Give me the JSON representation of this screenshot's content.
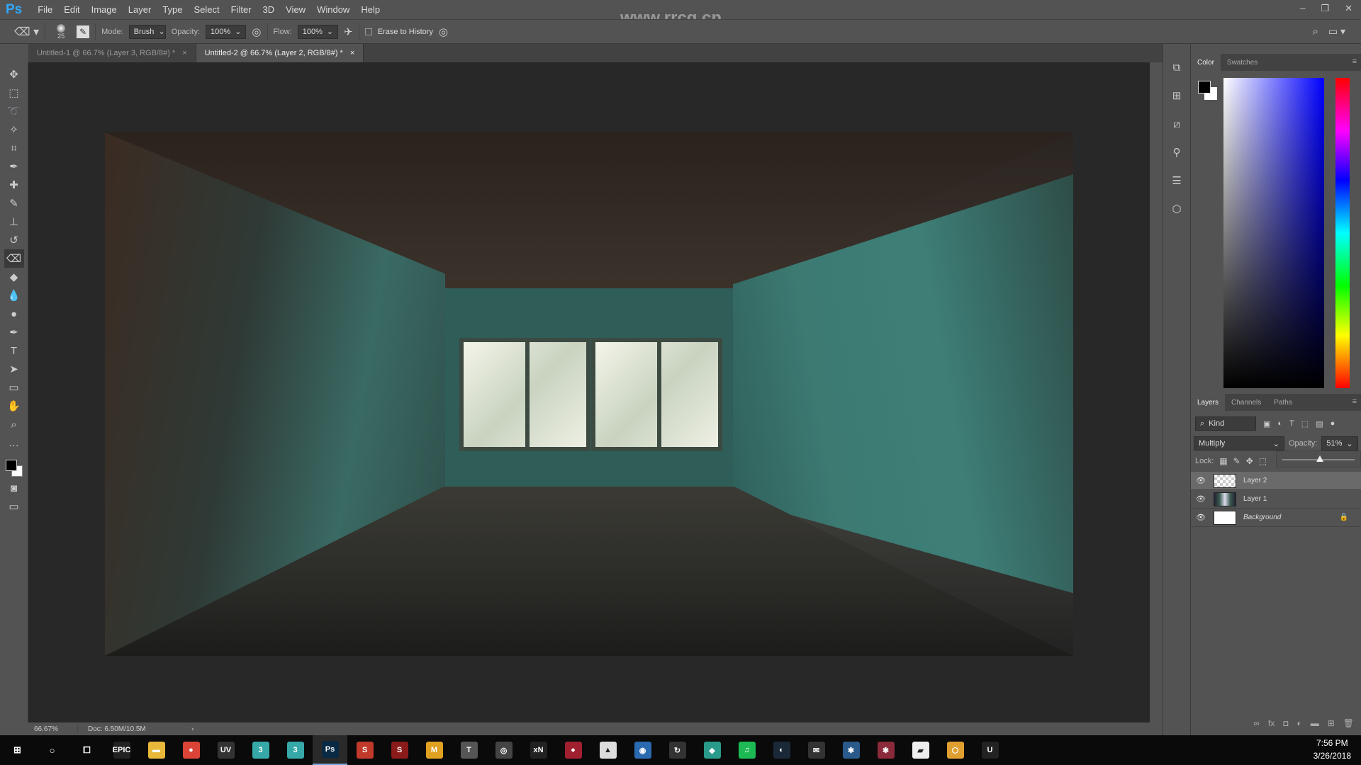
{
  "app": {
    "logo": "Ps",
    "watermark": "www.rrcg.cn"
  },
  "menu": [
    "File",
    "Edit",
    "Image",
    "Layer",
    "Type",
    "Select",
    "Filter",
    "3D",
    "View",
    "Window",
    "Help"
  ],
  "window_controls": [
    "–",
    "❐",
    "✕"
  ],
  "options": {
    "brush_size": "25",
    "mode_label": "Mode:",
    "mode_value": "Brush",
    "opacity_label": "Opacity:",
    "opacity_value": "100%",
    "flow_label": "Flow:",
    "flow_value": "100%",
    "erase_to_history": "Erase to History",
    "erase_to_history_checked": false
  },
  "tabs": [
    {
      "label": "Untitled-1 @ 66.7% (Layer 3, RGB/8#) *",
      "active": false
    },
    {
      "label": "Untitled-2 @ 66.7% (Layer 2, RGB/8#) *",
      "active": true
    }
  ],
  "tools": [
    "move-icon",
    "marquee-icon",
    "lasso-icon",
    "magic-wand-icon",
    "crop-icon",
    "eyedropper-icon",
    "healing-icon",
    "brush-icon",
    "stamp-icon",
    "history-brush-icon",
    "eraser-icon",
    "paint-bucket-icon",
    "blur-icon",
    "dodge-icon",
    "pen-icon",
    "type-icon",
    "path-select-icon",
    "rectangle-icon",
    "hand-icon",
    "zoom-icon",
    "more-icon"
  ],
  "status": {
    "zoom": "66.67%",
    "doc": "Doc: 6.50M/10.5M"
  },
  "color_panel": {
    "tabs": [
      "Color",
      "Swatches"
    ],
    "foreground": "#000000",
    "background": "#ffffff"
  },
  "layers_panel": {
    "tabs": [
      "Layers",
      "Channels",
      "Paths"
    ],
    "filter": "Kind",
    "blend_mode": "Multiply",
    "opacity_label": "Opacity:",
    "opacity_value": "51%",
    "opacity_percent": 51,
    "lock_label": "Lock:",
    "layers": [
      {
        "name": "Layer 2",
        "visible": true,
        "selected": true,
        "thumb": "transparent"
      },
      {
        "name": "Layer 1",
        "visible": true,
        "selected": false,
        "thumb": "image"
      },
      {
        "name": "Background",
        "visible": true,
        "selected": false,
        "thumb": "white",
        "locked": true
      }
    ]
  },
  "taskbar": {
    "apps": [
      {
        "name": "epic",
        "label": "EPIC",
        "color": "#222"
      },
      {
        "name": "explorer",
        "label": "▬",
        "color": "#e8b83a"
      },
      {
        "name": "chrome",
        "label": "●",
        "color": "#db4437"
      },
      {
        "name": "uv",
        "label": "UV",
        "color": "#333"
      },
      {
        "name": "3dsmax",
        "label": "3",
        "color": "#36a8a8"
      },
      {
        "name": "3dsmax2",
        "label": "3",
        "color": "#36a8a8"
      },
      {
        "name": "photoshop",
        "label": "Ps",
        "color": "#0a2a44",
        "active": true
      },
      {
        "name": "substance-painter",
        "label": "S",
        "color": "#c0392b"
      },
      {
        "name": "substance-designer",
        "label": "S",
        "color": "#8b1a1a"
      },
      {
        "name": "marmoset",
        "label": "M",
        "color": "#e0a020"
      },
      {
        "name": "tl",
        "label": "T",
        "color": "#555"
      },
      {
        "name": "app11",
        "label": "◎",
        "color": "#444"
      },
      {
        "name": "xnormal",
        "label": "xN",
        "color": "#222"
      },
      {
        "name": "app13",
        "label": "●",
        "color": "#a02030"
      },
      {
        "name": "app14",
        "label": "▲",
        "color": "#ddd"
      },
      {
        "name": "app15",
        "label": "◉",
        "color": "#2a6ab0"
      },
      {
        "name": "app16",
        "label": "↻",
        "color": "#333"
      },
      {
        "name": "app17",
        "label": "◆",
        "color": "#2a9a8a"
      },
      {
        "name": "spotify",
        "label": "♫",
        "color": "#1db954"
      },
      {
        "name": "steam",
        "label": "◐",
        "color": "#1b2838"
      },
      {
        "name": "mail",
        "label": "✉",
        "color": "#333"
      },
      {
        "name": "app21",
        "label": "✱",
        "color": "#2a5a8a"
      },
      {
        "name": "app22",
        "label": "✱",
        "color": "#8a2a3a"
      },
      {
        "name": "notes",
        "label": "▰",
        "color": "#eee"
      },
      {
        "name": "app24",
        "label": "⬡",
        "color": "#e0a030"
      },
      {
        "name": "unreal",
        "label": "U",
        "color": "#222"
      }
    ],
    "time": "7:56 PM",
    "date": "3/26/2018"
  }
}
